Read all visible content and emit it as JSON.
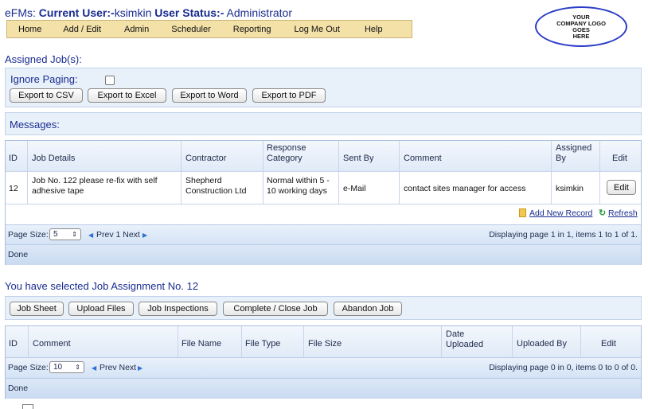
{
  "header": {
    "app_prefix": "eFMs:",
    "user_label": "Current User:-",
    "user_name": "ksimkin",
    "status_label": "User Status:-",
    "status_value": "Administrator"
  },
  "menu": [
    "Home",
    "Add / Edit",
    "Admin",
    "Scheduler",
    "Reporting",
    "Log Me Out",
    "Help"
  ],
  "logo": [
    "YOUR",
    "COMPANY LOGO",
    "GOES",
    "HERE"
  ],
  "assigned": {
    "title": "Assigned Job(s):",
    "ignore_paging": "Ignore Paging:",
    "exports": [
      "Export to CSV",
      "Export to Excel",
      "Export to Word",
      "Export to PDF"
    ]
  },
  "messages": {
    "title": "Messages:",
    "columns": [
      "ID",
      "Job Details",
      "Contractor",
      "Response Category",
      "Sent By",
      "Comment",
      "Assigned By",
      "Edit"
    ],
    "row": {
      "id": "12",
      "job_details": "Job No. 122 please re-fix with self adhesive tape",
      "contractor": "Shepherd Construction Ltd",
      "response": "Normal within 5 - 10 working days",
      "sent_by": "e-Mail",
      "comment": "contact sites manager for access",
      "assigned_by": "ksimkin",
      "edit": "Edit"
    },
    "add_new": "Add New Record",
    "refresh": "Refresh",
    "page_size_label": "Page Size:",
    "page_size": "5",
    "pager_nav": "Prev 1 Next",
    "displaying": "Displaying page 1 in 1, items 1 to 1 of 1.",
    "done": "Done"
  },
  "selected": {
    "title": "You have selected Job Assignment No. 12",
    "buttons": [
      "Job Sheet",
      "Upload Files",
      "Job Inspections",
      "Complete / Close Job",
      "Abandon Job"
    ],
    "columns": [
      "ID",
      "Comment",
      "File Name",
      "File Type",
      "File Size",
      "Date Uploaded",
      "Uploaded By",
      "Edit"
    ],
    "page_size_label": "Page Size:",
    "page_size": "10",
    "pager_nav": "Prev Next",
    "displaying": "Displaying page 0 in 0, items 0 to 0 of 0.",
    "done": "Done"
  },
  "colors": {
    "accent": "#1a2d8f",
    "menu_bg": "#f3e1a8",
    "panel_bg": "#e8f0fa"
  }
}
